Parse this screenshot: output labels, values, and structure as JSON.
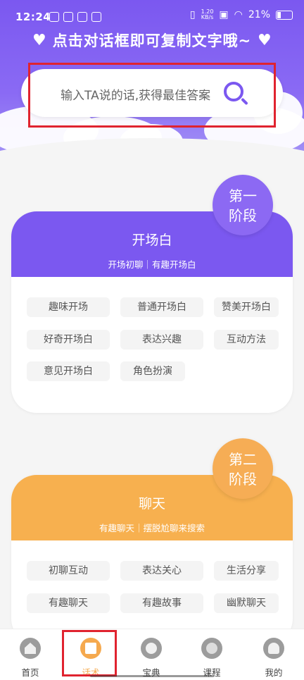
{
  "status_bar": {
    "time": "12:24",
    "net_speed_value": "1.20",
    "net_speed_unit": "KB/s",
    "battery": "21%"
  },
  "header": {
    "slogan": "点击对话框即可复制文字哦~"
  },
  "search": {
    "placeholder": "输入TA说的话,获得最佳答案"
  },
  "sections": [
    {
      "stage_line1": "第一",
      "stage_line2": "阶段",
      "title": "开场白",
      "subtitle": "开场初聊｜有趣开场白",
      "color": "#7b58f0",
      "stage_color": "#8c69f3",
      "tags": [
        "趣味开场",
        "普通开场白",
        "赞美开场白",
        "好奇开场白",
        "表达兴趣",
        "互动方法",
        "意见开场白",
        "角色扮演"
      ]
    },
    {
      "stage_line1": "第二",
      "stage_line2": "阶段",
      "title": "聊天",
      "subtitle": "有趣聊天｜摆脱尬聊来搜索",
      "color": "#f7b04f",
      "stage_color": "#f6ad55",
      "tags": [
        "初聊互动",
        "表达关心",
        "生活分享",
        "有趣聊天",
        "有趣故事",
        "幽默聊天"
      ]
    }
  ],
  "tabbar": {
    "tabs": [
      {
        "label": "首页",
        "icon": "home-icon"
      },
      {
        "label": "话术",
        "icon": "script-icon",
        "active": true
      },
      {
        "label": "宝典",
        "icon": "planet-icon"
      },
      {
        "label": "课程",
        "icon": "film-reel-icon"
      },
      {
        "label": "我的",
        "icon": "user-icon"
      }
    ]
  }
}
